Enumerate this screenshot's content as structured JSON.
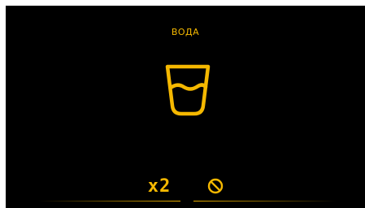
{
  "screen": {
    "title": "ВОДА",
    "icon": "water-glass-icon",
    "accent_color": "#f5b800",
    "background_color": "#000000"
  },
  "controls": {
    "portion_label": "x2",
    "cancel_icon": "no-entry-icon"
  }
}
